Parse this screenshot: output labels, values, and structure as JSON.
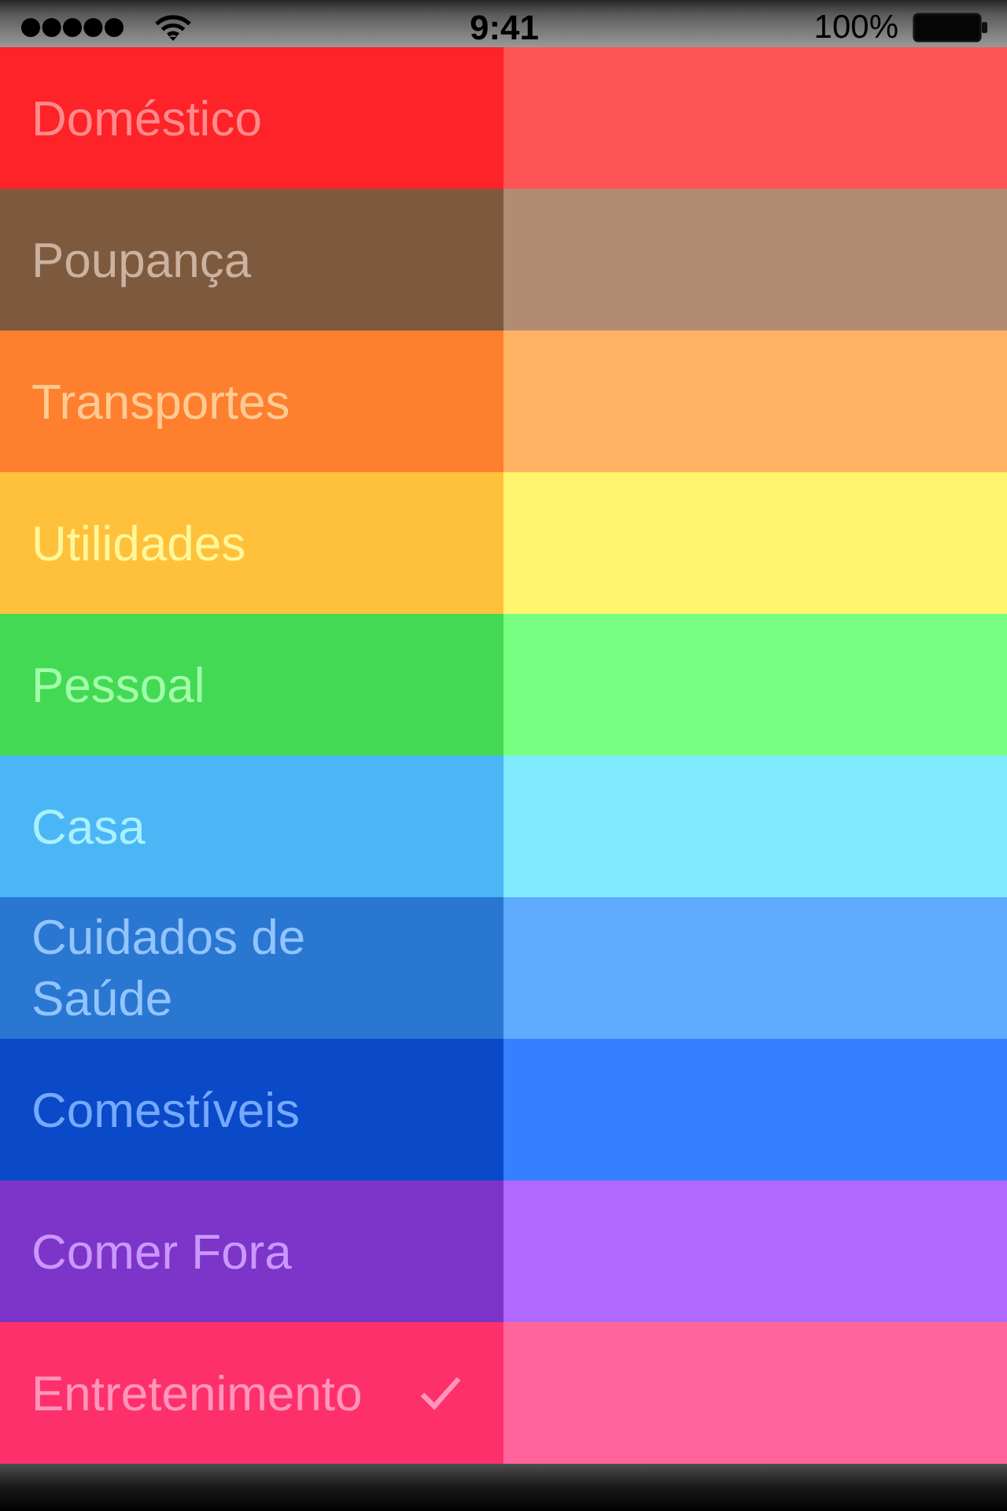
{
  "status_bar": {
    "time": "9:41",
    "battery": "100%"
  },
  "categories": [
    {
      "label": "Doméstico",
      "color": "#fe2229",
      "swatch": {
        "color": "#fe5454"
      },
      "selected": false
    },
    {
      "label": "Poupança",
      "color": "#7d5a3e",
      "swatch": {
        "color": "#b28c72"
      },
      "selected": false
    },
    {
      "label": "Transportes",
      "color": "#fe7f2e",
      "swatch": {
        "color": "#ffb262"
      },
      "selected": false
    },
    {
      "label": "Utilidades",
      "color": "#ffc13b",
      "swatch": {
        "color": "#fff46c"
      },
      "selected": false
    },
    {
      "label": "Pessoal",
      "color": "#43d955",
      "swatch": {
        "color": "#77ff82"
      },
      "selected": false
    },
    {
      "label": "Casa",
      "color": "#4ab6f6",
      "swatch": {
        "color": "#80eaff"
      },
      "selected": false
    },
    {
      "label": "Cuidados de Saúde",
      "color": "#2a77d2",
      "swatch": {
        "color": "#5eaaff"
      },
      "selected": false
    },
    {
      "label": "Comestíveis",
      "color": "#0a4ac8",
      "swatch": {
        "color": "#3680ff"
      },
      "selected": false
    },
    {
      "label": "Comer Fora",
      "color": "#7d34c8",
      "swatch": {
        "color": "#b068ff"
      },
      "selected": false
    },
    {
      "label": "Entretenimento",
      "color": "#fe306b",
      "swatch": {
        "color": "#ff659b"
      },
      "selected": true
    }
  ]
}
